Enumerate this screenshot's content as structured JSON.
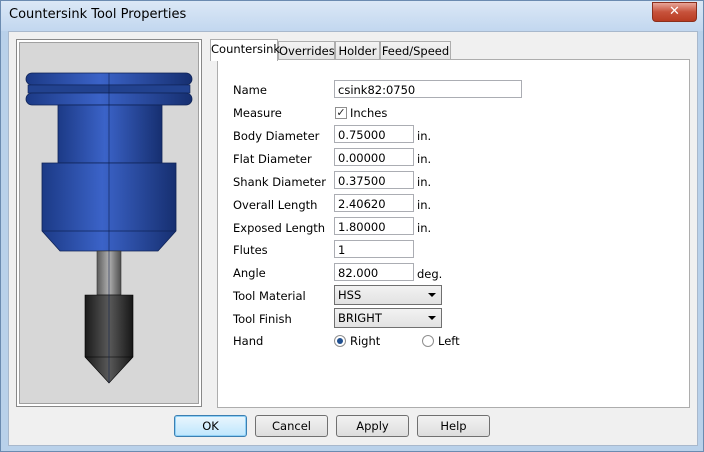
{
  "window": {
    "title": "Countersink Tool Properties",
    "close_glyph": "✕"
  },
  "tabs": [
    {
      "label": "Countersink",
      "active": true
    },
    {
      "label": "Overrides",
      "active": false
    },
    {
      "label": "Holder",
      "active": false
    },
    {
      "label": "Feed/Speed",
      "active": false
    }
  ],
  "form": {
    "name": {
      "label": "Name",
      "value": "csink82:0750"
    },
    "measure": {
      "label": "Measure",
      "checkbox_label": "Inches",
      "checked": true,
      "check_glyph": "✓"
    },
    "body_diameter": {
      "label": "Body Diameter",
      "value": "0.75000",
      "unit": "in."
    },
    "flat_diameter": {
      "label": "Flat Diameter",
      "value": "0.00000",
      "unit": "in."
    },
    "shank_diameter": {
      "label": "Shank Diameter",
      "value": "0.37500",
      "unit": "in."
    },
    "overall_length": {
      "label": "Overall Length",
      "value": "2.40620",
      "unit": "in."
    },
    "exposed_length": {
      "label": "Exposed Length",
      "value": "1.80000",
      "unit": "in."
    },
    "flutes": {
      "label": "Flutes",
      "value": "1"
    },
    "angle": {
      "label": "Angle",
      "value": "82.000",
      "unit": "deg."
    },
    "tool_material": {
      "label": "Tool Material",
      "value": "HSS"
    },
    "tool_finish": {
      "label": "Tool Finish",
      "value": "BRIGHT"
    },
    "hand": {
      "label": "Hand",
      "right_label": "Right",
      "left_label": "Left",
      "selected": "Right"
    }
  },
  "buttons": {
    "ok": "OK",
    "cancel": "Cancel",
    "apply": "Apply",
    "help": "Help"
  },
  "colors": {
    "tool_blue": "#2a4fa8",
    "shank_gray": "#7a7a7a",
    "cone_dark": "#2b2b2b"
  }
}
